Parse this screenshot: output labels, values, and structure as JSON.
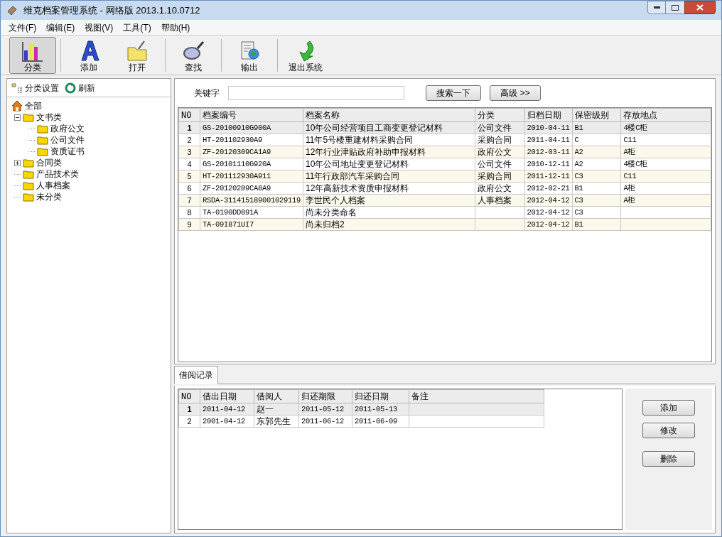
{
  "window": {
    "title": "维克档案管理系统 - 网络版 2013.1.10.0712"
  },
  "menu": [
    "文件(F)",
    "编辑(E)",
    "视图(V)",
    "工具(T)",
    "帮助(H)"
  ],
  "toolbar": [
    {
      "label": "分类",
      "kind": "chart",
      "selected": true
    },
    {
      "label": "添加",
      "kind": "letter",
      "selected": false
    },
    {
      "label": "打开",
      "kind": "folder",
      "selected": false
    },
    {
      "label": "查找",
      "kind": "magnifier",
      "selected": false
    },
    {
      "label": "输出",
      "kind": "export",
      "selected": false
    },
    {
      "label": "退出系统",
      "kind": "exit",
      "selected": false
    }
  ],
  "sidebar": {
    "actions": [
      {
        "label": "分类设置",
        "kind": "settings"
      },
      {
        "label": "刷新",
        "kind": "refresh"
      }
    ],
    "tree": [
      {
        "label": "全部",
        "kind": "root",
        "children": [
          {
            "label": "文书类",
            "kind": "group",
            "expanded": true,
            "children": [
              {
                "label": "政府公文",
                "kind": "leaf"
              },
              {
                "label": "公司文件",
                "kind": "leaf"
              },
              {
                "label": "资质证书",
                "kind": "leaf"
              }
            ]
          },
          {
            "label": "合同类",
            "kind": "group",
            "expanded": false
          },
          {
            "label": "产品技术类",
            "kind": "leaf"
          },
          {
            "label": "人事档案",
            "kind": "leaf"
          },
          {
            "label": "未分类",
            "kind": "leaf"
          }
        ]
      }
    ]
  },
  "search": {
    "label": "关键字",
    "buttons": [
      "搜索一下",
      "高级 >>"
    ]
  },
  "table": {
    "columns": [
      "NO",
      "档案编号",
      "档案名称",
      "分类",
      "归档日期",
      "保密级别",
      "存放地点"
    ],
    "rows": [
      {
        "selected": true,
        "cells": [
          "1",
          "GS-20100910G900A",
          "10年公司经营项目工商变更登记材料",
          "公司文件",
          "2010-04-11",
          "B1",
          "4楼C柜"
        ]
      },
      {
        "selected": false,
        "cells": [
          "2",
          "HT-201102930A9",
          "11年5号楼重建材料采购合同",
          "采购合同",
          "2011-04-11",
          "C",
          "C11"
        ]
      },
      {
        "selected": false,
        "cells": [
          "3",
          "ZF-20120309CA1A9",
          "12年行业津贴政府补助申报材料",
          "政府公文",
          "2012-03-11",
          "A2",
          "A柜"
        ]
      },
      {
        "selected": false,
        "cells": [
          "4",
          "GS-20101110G920A",
          "10年公司地址变更登记材料",
          "公司文件",
          "2010-12-11",
          "A2",
          "4楼C柜"
        ]
      },
      {
        "selected": false,
        "cells": [
          "5",
          "HT-201112930A911",
          "11年行政部汽车采购合同",
          "采购合同",
          "2011-12-11",
          "C3",
          "C11"
        ]
      },
      {
        "selected": false,
        "cells": [
          "6",
          "ZF-20120209CA8A9",
          "12年高新技术资质申报材料",
          "政府公文",
          "2012-02-21",
          "B1",
          "A柜"
        ]
      },
      {
        "selected": false,
        "cells": [
          "7",
          "RSDA-311415189001029119",
          "李世民个人档案",
          "人事档案",
          "2012-04-12",
          "C3",
          "A柜"
        ]
      },
      {
        "selected": false,
        "cells": [
          "8",
          "TA-0190DD891A",
          "尚未分类命名",
          "",
          "2012-04-12",
          "C3",
          ""
        ]
      },
      {
        "selected": false,
        "cells": [
          "9",
          "TA-09I871UI7",
          "尚未归档2",
          "",
          "2012-04-12",
          "B1",
          ""
        ]
      }
    ]
  },
  "tabs": [
    {
      "label": "借阅记录",
      "selected": true
    }
  ],
  "loan_table": {
    "columns": [
      "NO",
      "借出日期",
      "借阅人",
      "归还期限",
      "归还日期",
      "备注"
    ],
    "rows": [
      {
        "selected": true,
        "cells": [
          "1",
          "2011-04-12",
          "赵一",
          "2011-05-12",
          "2011-05-13",
          ""
        ]
      },
      {
        "selected": false,
        "cells": [
          "2",
          "2001-04-12",
          "东郭先生",
          "2011-06-12",
          "2011-06-09",
          ""
        ]
      }
    ]
  },
  "loan_buttons": [
    "添加",
    "修改",
    "删除"
  ]
}
